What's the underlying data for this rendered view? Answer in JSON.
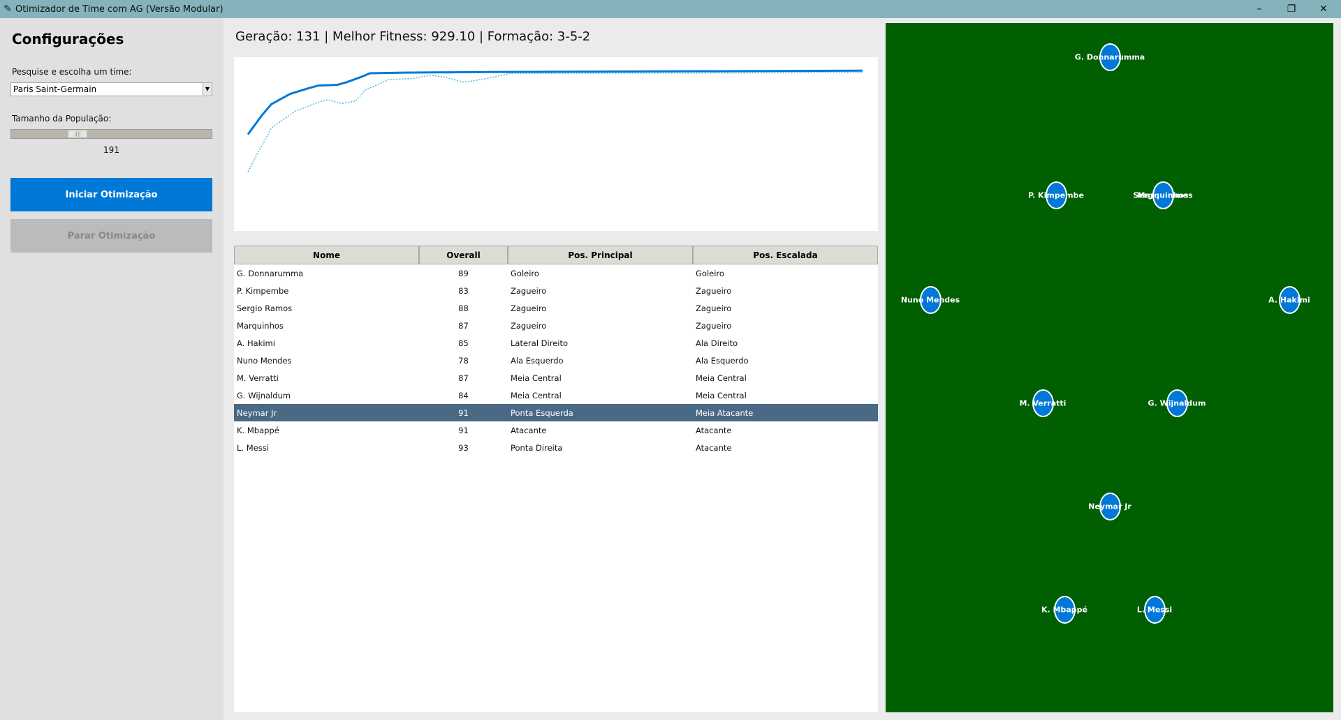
{
  "window": {
    "title": "Otimizador de Time com AG (Versão Modular)",
    "minimize": "–",
    "maximize": "❐",
    "close": "✕"
  },
  "sidebar": {
    "heading": "Configurações",
    "team_label": "Pesquise e escolha um time:",
    "team_value": "Paris Saint-Germain",
    "population_label": "Tamanho da População:",
    "population_value": "191",
    "population_fraction": 0.3,
    "start_label": "Iniciar Otimização",
    "stop_label": "Parar Otimização"
  },
  "status": "Geração: 131 | Melhor Fitness: 929.10 | Formação: 3-5-2",
  "chart_data": {
    "type": "line",
    "title": "",
    "xlabel": "",
    "ylabel": "",
    "xlim": [
      0,
      131
    ],
    "ylim": [
      680,
      950
    ],
    "grid": false,
    "series": [
      {
        "name": "best",
        "color": "#0078d7",
        "style": "solid",
        "points": [
          [
            0,
            830
          ],
          [
            3,
            860
          ],
          [
            5,
            877
          ],
          [
            9,
            893
          ],
          [
            13,
            902
          ],
          [
            15,
            906
          ],
          [
            19,
            907
          ],
          [
            21,
            911
          ],
          [
            24,
            919
          ],
          [
            26,
            925
          ],
          [
            33,
            926
          ],
          [
            51,
            927
          ],
          [
            131,
            929.1
          ]
        ]
      },
      {
        "name": "average",
        "color": "#4bb8e0",
        "style": "dotted",
        "points": [
          [
            0,
            772
          ],
          [
            2,
            800
          ],
          [
            5,
            840
          ],
          [
            10,
            866
          ],
          [
            15,
            880
          ],
          [
            17,
            884
          ],
          [
            20,
            878
          ],
          [
            23,
            882
          ],
          [
            25,
            899
          ],
          [
            30,
            915
          ],
          [
            35,
            917
          ],
          [
            39,
            922
          ],
          [
            42,
            919
          ],
          [
            46,
            911
          ],
          [
            51,
            917
          ],
          [
            56,
            925
          ],
          [
            131,
            926
          ]
        ]
      }
    ]
  },
  "table": {
    "headers": [
      "Nome",
      "Overall",
      "Pos. Principal",
      "Pos. Escalada"
    ],
    "rows": [
      [
        "G. Donnarumma",
        "89",
        "Goleiro",
        "Goleiro"
      ],
      [
        "P. Kimpembe",
        "83",
        "Zagueiro",
        "Zagueiro"
      ],
      [
        "Sergio Ramos",
        "88",
        "Zagueiro",
        "Zagueiro"
      ],
      [
        "Marquinhos",
        "87",
        "Zagueiro",
        "Zagueiro"
      ],
      [
        "A. Hakimi",
        "85",
        "Lateral Direito",
        "Ala Direito"
      ],
      [
        "Nuno Mendes",
        "78",
        "Ala Esquerdo",
        "Ala Esquerdo"
      ],
      [
        "M. Verratti",
        "87",
        "Meia Central",
        "Meia Central"
      ],
      [
        "G. Wijnaldum",
        "84",
        "Meia Central",
        "Meia Central"
      ],
      [
        "Neymar Jr",
        "91",
        "Ponta Esquerda",
        "Meia Atacante"
      ],
      [
        "K. Mbappé",
        "91",
        "Atacante",
        "Atacante"
      ],
      [
        "L. Messi",
        "93",
        "Ponta Direita",
        "Atacante"
      ]
    ],
    "selected_index": 8
  },
  "pitch": {
    "players": [
      "G. Donnarumma",
      "P. Kimpembe",
      "Sergio Ramos",
      "Marquinhos",
      "Nuno Mendes",
      "A. Hakimi",
      "M. Verratti",
      "G. Wijnaldum",
      "Neymar Jr",
      "K. Mbappé",
      "L. Messi"
    ]
  }
}
